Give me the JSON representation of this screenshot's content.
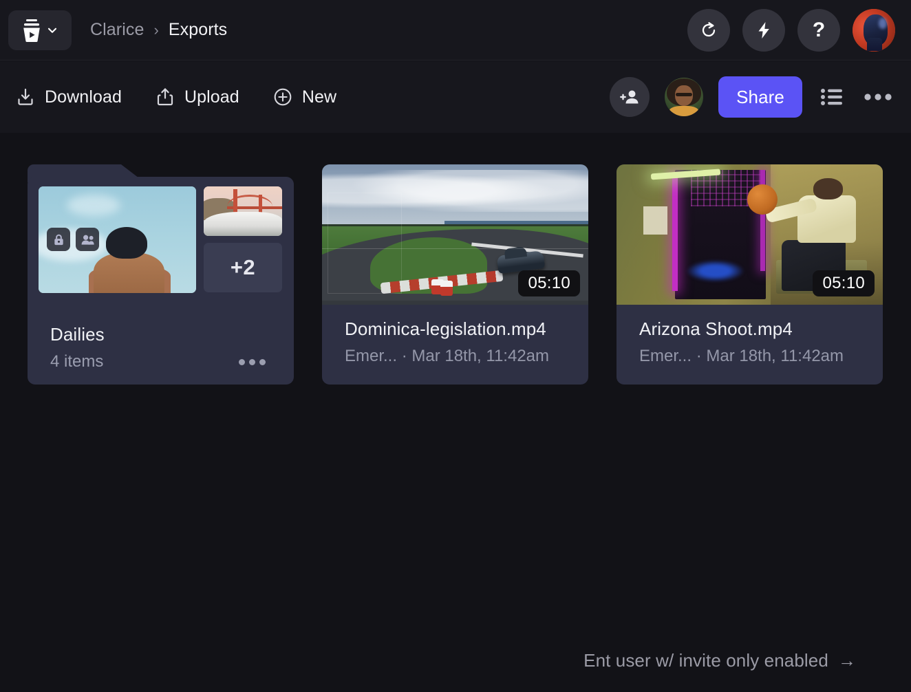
{
  "header": {
    "logo": {
      "icon": "frameio-cup-logo",
      "chevron_icon": "chevron-down-icon"
    },
    "breadcrumb": {
      "parent": "Clarice",
      "separator": "›",
      "current": "Exports"
    },
    "actions": [
      {
        "name": "refresh",
        "icon": "refresh-icon"
      },
      {
        "name": "lightning",
        "icon": "lightning-bolt-icon"
      },
      {
        "name": "help",
        "icon": "question-mark-icon",
        "label": "?"
      }
    ],
    "user_avatar": {
      "name": "user-avatar"
    }
  },
  "toolbar": {
    "download_label": "Download",
    "upload_label": "Upload",
    "new_label": "New",
    "share_label": "Share",
    "add_person_icon": "add-person-icon",
    "list_view_icon": "list-view-icon",
    "more_icon": "more-options-icon",
    "accent_color": "#5b53f5"
  },
  "content": {
    "folder": {
      "name": "Dailies",
      "item_count": "4 items",
      "overflow_count": "+2",
      "badges": [
        "lock-icon",
        "people-icon"
      ],
      "more_icon": "more-options-icon"
    },
    "assets": [
      {
        "name": "Dominica-legislation.mp4",
        "meta": "Emer... · Mar 18th, 11:42am",
        "duration": "05:10",
        "thumbnail": "racetrack-with-car"
      },
      {
        "name": "Arizona Shoot.mp4",
        "meta": "Emer... · Mar 18th, 11:42am",
        "duration": "05:10",
        "thumbnail": "person-with-basketball-neon-room"
      }
    ]
  },
  "footer": {
    "hint_text": "Ent user w/ invite only enabled",
    "hint_arrow": "→"
  },
  "colors": {
    "page_bg": "#121217",
    "chrome_bg": "#17171d",
    "card_bg": "#2e3044",
    "accent": "#5b53f5"
  }
}
